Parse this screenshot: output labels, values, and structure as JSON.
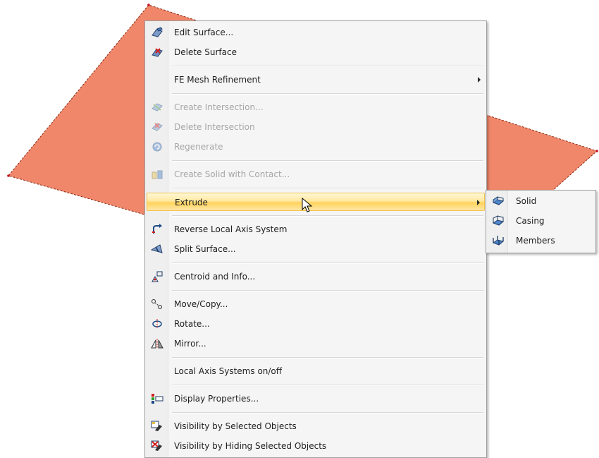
{
  "context_menu": {
    "items": [
      {
        "label": "Edit Surface...",
        "icon": "edit-surface-icon",
        "disabled": false
      },
      {
        "label": "Delete Surface",
        "icon": "delete-surface-icon",
        "disabled": false
      },
      {
        "label": "FE Mesh Refinement",
        "icon": "",
        "disabled": false,
        "submenu": true
      },
      {
        "label": "Create Intersection...",
        "icon": "create-intersection-icon",
        "disabled": true
      },
      {
        "label": "Delete Intersection",
        "icon": "delete-intersection-icon",
        "disabled": true
      },
      {
        "label": "Regenerate",
        "icon": "regenerate-icon",
        "disabled": true
      },
      {
        "label": "Create Solid with Contact...",
        "icon": "create-solid-contact-icon",
        "disabled": true
      },
      {
        "label": "Extrude",
        "icon": "",
        "disabled": false,
        "submenu": true,
        "highlighted": true
      },
      {
        "label": "Reverse Local Axis System",
        "icon": "reverse-axis-icon",
        "disabled": false
      },
      {
        "label": "Split Surface...",
        "icon": "split-surface-icon",
        "disabled": false
      },
      {
        "label": "Centroid and Info...",
        "icon": "centroid-info-icon",
        "disabled": false
      },
      {
        "label": "Move/Copy...",
        "icon": "move-copy-icon",
        "disabled": false
      },
      {
        "label": "Rotate...",
        "icon": "rotate-icon",
        "disabled": false
      },
      {
        "label": "Mirror...",
        "icon": "mirror-icon",
        "disabled": false
      },
      {
        "label": "Local Axis Systems on/off",
        "icon": "",
        "disabled": false
      },
      {
        "label": "Display Properties...",
        "icon": "display-properties-icon",
        "disabled": false
      },
      {
        "label": "Visibility by Selected Objects",
        "icon": "visibility-selected-icon",
        "disabled": false
      },
      {
        "label": "Visibility by Hiding Selected Objects",
        "icon": "visibility-hiding-icon",
        "disabled": false
      }
    ]
  },
  "extrude_submenu": {
    "items": [
      {
        "label": "Solid",
        "icon": "extrude-solid-icon"
      },
      {
        "label": "Casing",
        "icon": "extrude-casing-icon"
      },
      {
        "label": "Members",
        "icon": "extrude-members-icon"
      }
    ]
  },
  "colors": {
    "surface_fill": "#f0876a",
    "surface_edge": "#8a2a14",
    "highlight": "#ffd35c"
  }
}
